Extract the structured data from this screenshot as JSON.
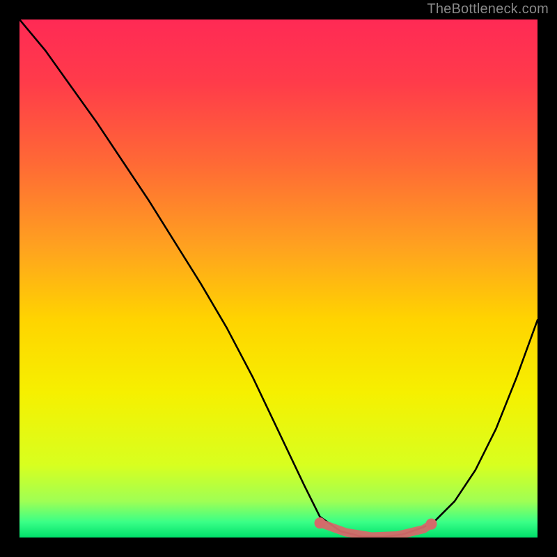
{
  "watermark": "TheBottleneck.com",
  "chart_data": {
    "type": "line",
    "title": "",
    "xlabel": "",
    "ylabel": "",
    "xlim": [
      0,
      100
    ],
    "ylim": [
      0,
      100
    ],
    "background_gradient_stops": [
      {
        "offset": 0.0,
        "color": "#ff2a55"
      },
      {
        "offset": 0.12,
        "color": "#ff3b4a"
      },
      {
        "offset": 0.28,
        "color": "#ff6a35"
      },
      {
        "offset": 0.44,
        "color": "#ffa21f"
      },
      {
        "offset": 0.58,
        "color": "#ffd400"
      },
      {
        "offset": 0.72,
        "color": "#f6f000"
      },
      {
        "offset": 0.86,
        "color": "#d8ff1f"
      },
      {
        "offset": 0.93,
        "color": "#9fff54"
      },
      {
        "offset": 0.97,
        "color": "#3aff87"
      },
      {
        "offset": 1.0,
        "color": "#00e06b"
      }
    ],
    "series": [
      {
        "name": "curve",
        "color": "#000000",
        "x": [
          0,
          5,
          10,
          15,
          20,
          25,
          30,
          35,
          40,
          45,
          50,
          55,
          58,
          62,
          66,
          70,
          74,
          78,
          80,
          84,
          88,
          92,
          96,
          100
        ],
        "values": [
          100,
          94,
          87,
          80,
          72.5,
          65,
          57,
          49,
          40.5,
          31,
          20.5,
          10,
          4,
          1.2,
          0.2,
          0.1,
          0.6,
          2,
          3,
          7,
          13,
          21,
          31,
          42
        ]
      }
    ],
    "highlight": {
      "name": "highlight-band",
      "color": "#d46a6a",
      "points_x": [
        58,
        63,
        68,
        73,
        78,
        79.5
      ],
      "points_y": [
        2.8,
        1.0,
        0.2,
        0.4,
        1.6,
        2.6
      ]
    }
  }
}
